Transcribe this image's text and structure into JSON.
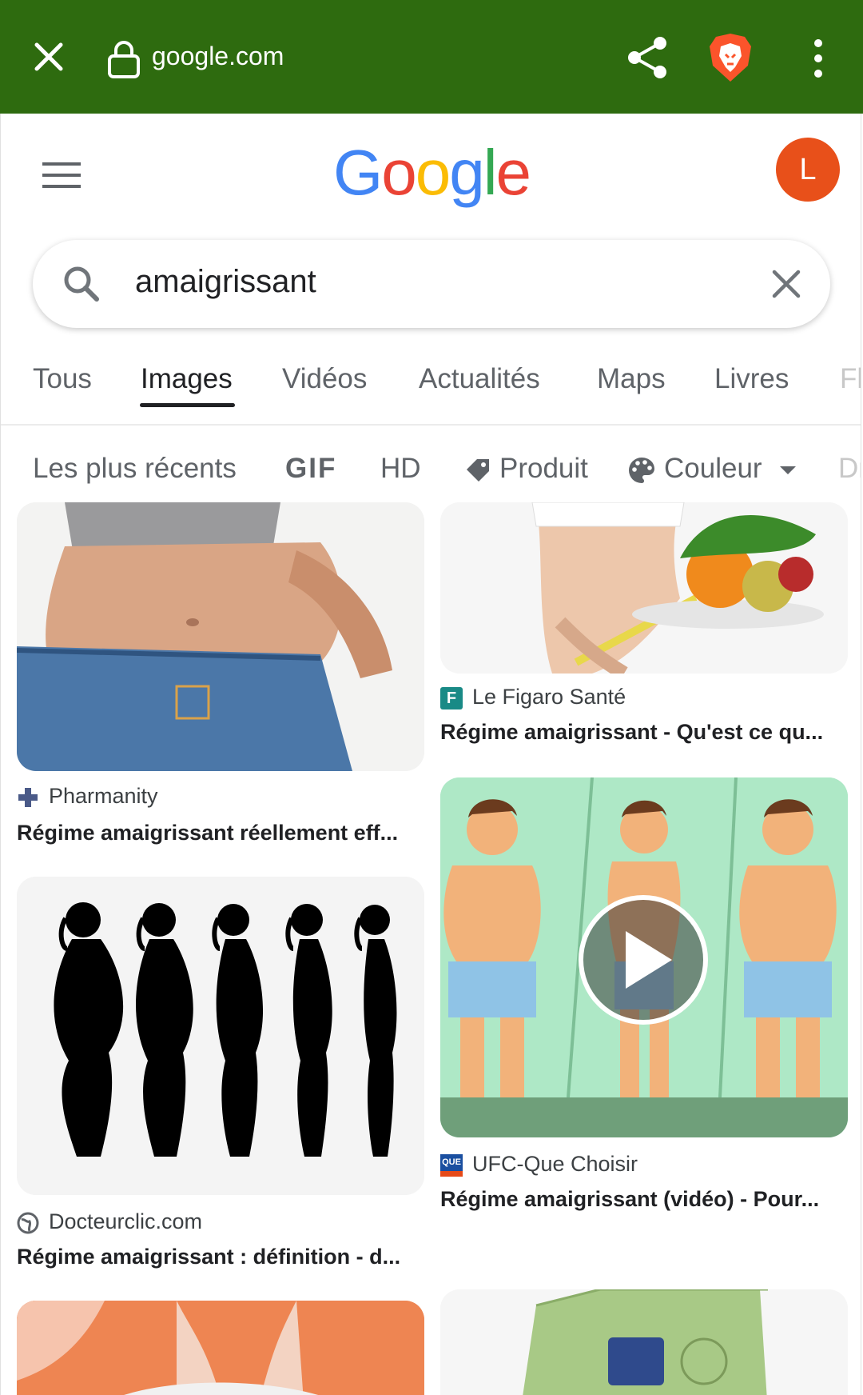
{
  "browser": {
    "url": "google.com",
    "toolbar_color": "#2e6b0f"
  },
  "header": {
    "logo_letters": [
      "G",
      "o",
      "o",
      "g",
      "l",
      "e"
    ],
    "logo_colors": [
      "#4285f4",
      "#ea4335",
      "#fbbc05",
      "#4285f4",
      "#34a853",
      "#ea4335"
    ],
    "avatar_letter": "L",
    "avatar_color": "#e8501a"
  },
  "search": {
    "query": "amaigrissant"
  },
  "tabs": [
    {
      "label": "Tous"
    },
    {
      "label": "Images",
      "active": true
    },
    {
      "label": "Vidéos"
    },
    {
      "label": "Actualités"
    },
    {
      "label": "Maps"
    },
    {
      "label": "Livres"
    },
    {
      "label": "Fl"
    }
  ],
  "chips": [
    {
      "label": "Les plus récents"
    },
    {
      "label": "GIF"
    },
    {
      "label": "HD"
    },
    {
      "label": "Produit",
      "icon": "tag-icon"
    },
    {
      "label": "Couleur",
      "icon": "palette-icon"
    },
    {
      "label": "Dr"
    }
  ],
  "results": [
    {
      "source": "Pharmanity",
      "title": "Régime amaigrissant réellement eff...",
      "favicon": "pharmacy-cross-icon"
    },
    {
      "source": "Le Figaro Santé",
      "title": "Régime amaigrissant - Qu'est ce qu...",
      "favicon": "figaro-icon"
    },
    {
      "source": "Docteurclic.com",
      "title": "Régime amaigrissant : définition - d...",
      "favicon": "globe-icon"
    },
    {
      "source": "UFC-Que Choisir",
      "title": "Régime amaigrissant (vidéo) - Pour...",
      "favicon": "que-choisir-icon"
    }
  ],
  "favicon_texts": {
    "figaro": "F",
    "que_choisir": "QUE"
  }
}
